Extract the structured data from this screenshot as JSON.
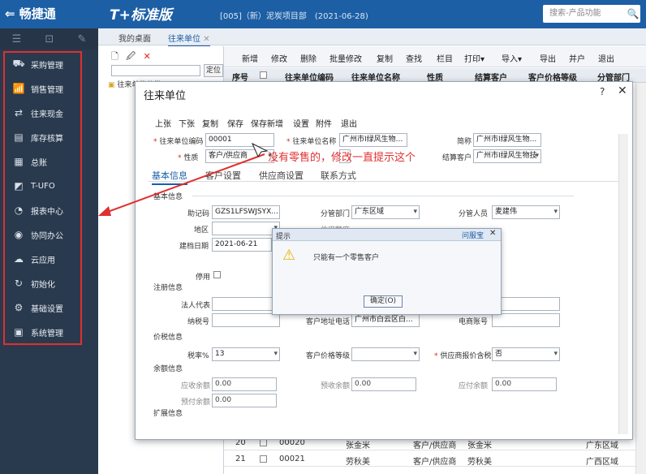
{
  "app": {
    "logo": "畅捷通",
    "title": "T+标准版",
    "account": "[005]（新）泥炭项目部　(2021-06-28)",
    "search_placeholder": "搜索-产品功能"
  },
  "menu": [
    {
      "label": "采购管理",
      "icon": "cart-icon"
    },
    {
      "label": "销售管理",
      "icon": "sales-chart-icon"
    },
    {
      "label": "往来现金",
      "icon": "exchange-icon"
    },
    {
      "label": "库存核算",
      "icon": "warehouse-icon"
    },
    {
      "label": "总账",
      "icon": "ledger-icon"
    },
    {
      "label": "T-UFO",
      "icon": "ufo-icon"
    },
    {
      "label": "报表中心",
      "icon": "pie-chart-icon"
    },
    {
      "label": "协同办公",
      "icon": "collab-icon"
    },
    {
      "label": "云应用",
      "icon": "cloud-icon"
    },
    {
      "label": "初始化",
      "icon": "refresh-icon"
    },
    {
      "label": "基础设置",
      "icon": "settings-icon"
    },
    {
      "label": "系统管理",
      "icon": "system-icon"
    }
  ],
  "tabs": {
    "home": "我的桌面",
    "current": "往来单位"
  },
  "leftpane": {
    "locate_button": "定位",
    "tree_root": "往来单位分类"
  },
  "list_toolbar": [
    "新增",
    "修改",
    "删除",
    "批量修改",
    "复制",
    "查找",
    "栏目",
    "打印▾",
    "导入▾",
    "导出",
    "并户",
    "退出"
  ],
  "list_headers": [
    "序号",
    "往来单位编码",
    "往来单位名称",
    "性质",
    "结算客户",
    "客户价格等级",
    "分管部门"
  ],
  "list_rows": [
    {
      "no": "20",
      "code": "00020",
      "name": "张金米",
      "type": "客户/供应商",
      "settle": "张金米",
      "region": "广东区域"
    },
    {
      "no": "21",
      "code": "00021",
      "name": "劳秋美",
      "type": "客户/供应商",
      "settle": "劳秋美",
      "region": "广西区域"
    }
  ],
  "dialog": {
    "title": "往来单位",
    "toolbar": [
      "上张",
      "下张",
      "复制",
      "保存",
      "保存新增",
      "设置",
      "附件",
      "退出"
    ],
    "top_fields": {
      "code_label": "往来单位编码",
      "code_value": "00001",
      "name_label": "往来单位名称",
      "name_value": "广州市I绿风生物...",
      "short_label": "简称",
      "short_value": "广州市I绿风生物...",
      "type_label": "性质",
      "type_value": "客户/供应商",
      "settle_label": "结算客户",
      "settle_value": "广州市I绿风生物技"
    },
    "tabs": [
      "基本信息",
      "客户设置",
      "供应商设置",
      "联系方式"
    ],
    "sections": {
      "basic": "基本信息",
      "reg": "注册信息",
      "tax": "价税信息",
      "balance": "余额信息",
      "ext": "扩展信息"
    },
    "basic": {
      "mnemonic_label": "助记码",
      "mnemonic_value": "GZS1LFSWJSYX...",
      "dept_label": "分管部门",
      "dept_value": "广东区域",
      "staff_label": "分管人员",
      "staff_value": "麦建伟",
      "area_label": "地区",
      "credit_label": "信用额度",
      "date_label": "建档日期",
      "date_value": "2021-06-21",
      "disabled_label": "停用"
    },
    "reg": {
      "legal_label": "法人代表",
      "taxno_label": "纳税号",
      "addr_label": "客户地址电话",
      "addr_value": "广州市白云区白...",
      "phone_label": "电商账号"
    },
    "tax": {
      "rate_label": "税率%",
      "rate_value": "13",
      "price_label": "客户价格等级",
      "incl_label": "供应商报价含税",
      "incl_value": "否"
    },
    "balance": {
      "ar_label": "应收余额",
      "ar_value": "0.00",
      "pre_recv_label": "预收余额",
      "pre_recv_value": "0.00",
      "ap_label": "应付余额",
      "ap_value": "0.00",
      "prepay_label": "预付余额",
      "prepay_value": "0.00"
    }
  },
  "alert": {
    "title": "提示",
    "help": "问服宝",
    "message": "只能有一个零售客户",
    "ok": "确定(O)"
  },
  "annotation": "没有零售的，修改一直提示这个",
  "colors": {
    "sidebar": "#2a3a4e",
    "brand": "#1d5fa5",
    "annotation": "#e03030",
    "tab_active": "#1d5fa5"
  }
}
